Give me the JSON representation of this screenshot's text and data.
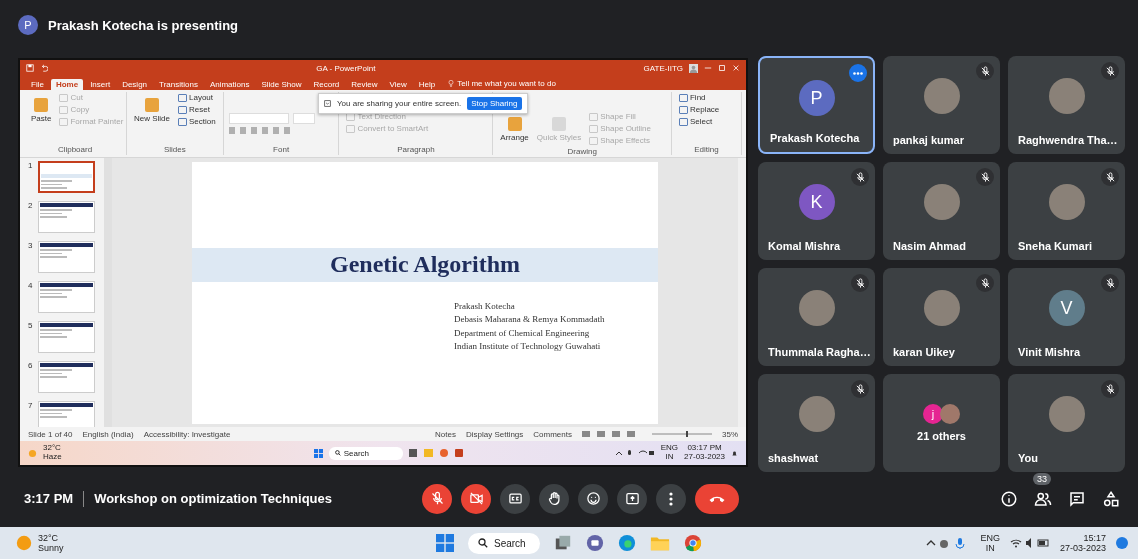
{
  "presenter_banner": {
    "avatar_letter": "P",
    "text": "Prakash Kotecha is presenting"
  },
  "shared_screen": {
    "title": "GA - PowerPoint",
    "account": "GATE-IITG",
    "ribbon_tabs": [
      {
        "label": "File",
        "selected": false
      },
      {
        "label": "Home",
        "selected": true
      },
      {
        "label": "Insert",
        "selected": false
      },
      {
        "label": "Design",
        "selected": false
      },
      {
        "label": "Transitions",
        "selected": false
      },
      {
        "label": "Animations",
        "selected": false
      },
      {
        "label": "Slide Show",
        "selected": false
      },
      {
        "label": "Record",
        "selected": false
      },
      {
        "label": "Review",
        "selected": false
      },
      {
        "label": "View",
        "selected": false
      },
      {
        "label": "Help",
        "selected": false
      }
    ],
    "tell_me": "Tell me what you want to do",
    "ribbon_groups": [
      {
        "label": "Clipboard",
        "commands": [
          {
            "label": "Paste",
            "kind": "large",
            "disabled": false
          },
          {
            "label": "Cut",
            "kind": "small",
            "disabled": true
          },
          {
            "label": "Copy",
            "kind": "small",
            "disabled": true
          },
          {
            "label": "Format Painter",
            "kind": "small",
            "disabled": true
          }
        ]
      },
      {
        "label": "Slides",
        "commands": [
          {
            "label": "New Slide",
            "kind": "large",
            "disabled": false
          },
          {
            "label": "Layout",
            "kind": "small",
            "disabled": false
          },
          {
            "label": "Reset",
            "kind": "small",
            "disabled": false
          },
          {
            "label": "Section",
            "kind": "small",
            "disabled": false
          }
        ]
      },
      {
        "label": "Font"
      },
      {
        "label": "Paragraph",
        "commands": [
          {
            "label": "Text Direction",
            "kind": "small",
            "disabled": true
          },
          {
            "label": "Convert to SmartArt",
            "kind": "small",
            "disabled": true
          }
        ]
      },
      {
        "label": "Drawing",
        "commands": [
          {
            "label": "Arrange",
            "kind": "large",
            "disabled": false
          },
          {
            "label": "Quick Styles",
            "kind": "large",
            "disabled": true
          },
          {
            "label": "Shape Fill",
            "kind": "small",
            "disabled": true
          },
          {
            "label": "Shape Outline",
            "kind": "small",
            "disabled": true
          },
          {
            "label": "Shape Effects",
            "kind": "small",
            "disabled": true
          }
        ]
      },
      {
        "label": "Editing",
        "commands": [
          {
            "label": "Find",
            "kind": "small",
            "disabled": false
          },
          {
            "label": "Replace",
            "kind": "small",
            "disabled": false
          },
          {
            "label": "Select",
            "kind": "small",
            "disabled": false
          }
        ]
      }
    ],
    "sharing_banner": {
      "text": "You are sharing your entire screen.",
      "button": "Stop Sharing"
    },
    "slide_thumbnails": [
      {
        "number": "1",
        "selected": true
      },
      {
        "number": "2",
        "selected": false
      },
      {
        "number": "3",
        "selected": false
      },
      {
        "number": "4",
        "selected": false
      },
      {
        "number": "5",
        "selected": false
      },
      {
        "number": "6",
        "selected": false
      },
      {
        "number": "7",
        "selected": false
      }
    ],
    "slide": {
      "title": "Genetic Algorithm",
      "lines": [
        "Prakash Kotecha",
        "Debasis Maharana & Remya Kommadath",
        "Department of Chemical Engineering",
        "Indian Institute of Technology Guwahati"
      ]
    },
    "status_bar": {
      "slide_count": "Slide 1 of 40",
      "language": "English (India)",
      "accessibility": "Accessibility: Investigate",
      "notes": "Notes",
      "display_settings": "Display Settings",
      "comments": "Comments",
      "zoom": "35%"
    },
    "taskbar": {
      "temperature": "32°C",
      "weather": "Haze",
      "search": "Search",
      "language": "ENG",
      "region": "IN",
      "time": "03:17 PM",
      "date": "27-03-2023"
    }
  },
  "participants": [
    {
      "kind": "letter",
      "name": "Prakash Kotecha",
      "letter": "P",
      "color": "#5c6bc0",
      "muted": false,
      "highlighted": true
    },
    {
      "kind": "photo",
      "name": "pankaj kumar",
      "muted": true,
      "highlighted": false
    },
    {
      "kind": "photo",
      "name": "Raghwendra Tha…",
      "muted": true,
      "highlighted": false
    },
    {
      "kind": "letter",
      "name": "Komal Mishra",
      "letter": "K",
      "color": "#7e57c2",
      "muted": true,
      "highlighted": false
    },
    {
      "kind": "photo",
      "name": "Nasim Ahmad",
      "muted": true,
      "highlighted": false
    },
    {
      "kind": "photo",
      "name": "Sneha Kumari",
      "muted": true,
      "highlighted": false
    },
    {
      "kind": "photo",
      "name": "Thummala Ragha…",
      "muted": true,
      "highlighted": false
    },
    {
      "kind": "photo",
      "name": "karan Uikey",
      "muted": true,
      "highlighted": false
    },
    {
      "kind": "letter",
      "name": "Vinit Mishra",
      "letter": "V",
      "color": "#607d8b",
      "muted": true,
      "highlighted": false
    },
    {
      "kind": "photo",
      "name": "shashwat",
      "muted": true,
      "highlighted": false
    },
    {
      "kind": "others",
      "name": "21 others",
      "letter": "j",
      "color": "#e52592",
      "muted": false,
      "highlighted": false
    },
    {
      "kind": "photo",
      "name": "You",
      "muted": true,
      "highlighted": false
    }
  ],
  "meeting_bar": {
    "time": "3:17 PM",
    "title": "Workshop on optimization Techniques",
    "controls": [
      {
        "kind": "microphone",
        "off": true
      },
      {
        "kind": "camera",
        "off": true
      },
      {
        "kind": "captions"
      },
      {
        "kind": "raise-hand"
      },
      {
        "kind": "emoji"
      },
      {
        "kind": "present"
      },
      {
        "kind": "more"
      },
      {
        "kind": "leave"
      }
    ],
    "people_count": "33"
  },
  "taskbar": {
    "temperature": "32°C",
    "weather": "Sunny",
    "search": "Search",
    "language": "ENG",
    "region": "IN",
    "time": "15:17",
    "date": "27-03-2023"
  }
}
